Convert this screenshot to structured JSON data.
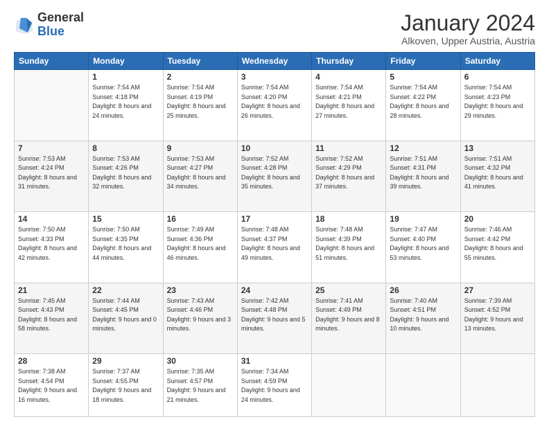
{
  "header": {
    "logo_general": "General",
    "logo_blue": "Blue",
    "title": "January 2024",
    "subtitle": "Alkoven, Upper Austria, Austria"
  },
  "days_of_week": [
    "Sunday",
    "Monday",
    "Tuesday",
    "Wednesday",
    "Thursday",
    "Friday",
    "Saturday"
  ],
  "weeks": [
    [
      {
        "day": "",
        "sunrise": "",
        "sunset": "",
        "daylight": ""
      },
      {
        "day": "1",
        "sunrise": "Sunrise: 7:54 AM",
        "sunset": "Sunset: 4:18 PM",
        "daylight": "Daylight: 8 hours and 24 minutes."
      },
      {
        "day": "2",
        "sunrise": "Sunrise: 7:54 AM",
        "sunset": "Sunset: 4:19 PM",
        "daylight": "Daylight: 8 hours and 25 minutes."
      },
      {
        "day": "3",
        "sunrise": "Sunrise: 7:54 AM",
        "sunset": "Sunset: 4:20 PM",
        "daylight": "Daylight: 8 hours and 26 minutes."
      },
      {
        "day": "4",
        "sunrise": "Sunrise: 7:54 AM",
        "sunset": "Sunset: 4:21 PM",
        "daylight": "Daylight: 8 hours and 27 minutes."
      },
      {
        "day": "5",
        "sunrise": "Sunrise: 7:54 AM",
        "sunset": "Sunset: 4:22 PM",
        "daylight": "Daylight: 8 hours and 28 minutes."
      },
      {
        "day": "6",
        "sunrise": "Sunrise: 7:54 AM",
        "sunset": "Sunset: 4:23 PM",
        "daylight": "Daylight: 8 hours and 29 minutes."
      }
    ],
    [
      {
        "day": "7",
        "sunrise": "Sunrise: 7:53 AM",
        "sunset": "Sunset: 4:24 PM",
        "daylight": "Daylight: 8 hours and 31 minutes."
      },
      {
        "day": "8",
        "sunrise": "Sunrise: 7:53 AM",
        "sunset": "Sunset: 4:26 PM",
        "daylight": "Daylight: 8 hours and 32 minutes."
      },
      {
        "day": "9",
        "sunrise": "Sunrise: 7:53 AM",
        "sunset": "Sunset: 4:27 PM",
        "daylight": "Daylight: 8 hours and 34 minutes."
      },
      {
        "day": "10",
        "sunrise": "Sunrise: 7:52 AM",
        "sunset": "Sunset: 4:28 PM",
        "daylight": "Daylight: 8 hours and 35 minutes."
      },
      {
        "day": "11",
        "sunrise": "Sunrise: 7:52 AM",
        "sunset": "Sunset: 4:29 PM",
        "daylight": "Daylight: 8 hours and 37 minutes."
      },
      {
        "day": "12",
        "sunrise": "Sunrise: 7:51 AM",
        "sunset": "Sunset: 4:31 PM",
        "daylight": "Daylight: 8 hours and 39 minutes."
      },
      {
        "day": "13",
        "sunrise": "Sunrise: 7:51 AM",
        "sunset": "Sunset: 4:32 PM",
        "daylight": "Daylight: 8 hours and 41 minutes."
      }
    ],
    [
      {
        "day": "14",
        "sunrise": "Sunrise: 7:50 AM",
        "sunset": "Sunset: 4:33 PM",
        "daylight": "Daylight: 8 hours and 42 minutes."
      },
      {
        "day": "15",
        "sunrise": "Sunrise: 7:50 AM",
        "sunset": "Sunset: 4:35 PM",
        "daylight": "Daylight: 8 hours and 44 minutes."
      },
      {
        "day": "16",
        "sunrise": "Sunrise: 7:49 AM",
        "sunset": "Sunset: 4:36 PM",
        "daylight": "Daylight: 8 hours and 46 minutes."
      },
      {
        "day": "17",
        "sunrise": "Sunrise: 7:48 AM",
        "sunset": "Sunset: 4:37 PM",
        "daylight": "Daylight: 8 hours and 49 minutes."
      },
      {
        "day": "18",
        "sunrise": "Sunrise: 7:48 AM",
        "sunset": "Sunset: 4:39 PM",
        "daylight": "Daylight: 8 hours and 51 minutes."
      },
      {
        "day": "19",
        "sunrise": "Sunrise: 7:47 AM",
        "sunset": "Sunset: 4:40 PM",
        "daylight": "Daylight: 8 hours and 53 minutes."
      },
      {
        "day": "20",
        "sunrise": "Sunrise: 7:46 AM",
        "sunset": "Sunset: 4:42 PM",
        "daylight": "Daylight: 8 hours and 55 minutes."
      }
    ],
    [
      {
        "day": "21",
        "sunrise": "Sunrise: 7:45 AM",
        "sunset": "Sunset: 4:43 PM",
        "daylight": "Daylight: 8 hours and 58 minutes."
      },
      {
        "day": "22",
        "sunrise": "Sunrise: 7:44 AM",
        "sunset": "Sunset: 4:45 PM",
        "daylight": "Daylight: 9 hours and 0 minutes."
      },
      {
        "day": "23",
        "sunrise": "Sunrise: 7:43 AM",
        "sunset": "Sunset: 4:46 PM",
        "daylight": "Daylight: 9 hours and 3 minutes."
      },
      {
        "day": "24",
        "sunrise": "Sunrise: 7:42 AM",
        "sunset": "Sunset: 4:48 PM",
        "daylight": "Daylight: 9 hours and 5 minutes."
      },
      {
        "day": "25",
        "sunrise": "Sunrise: 7:41 AM",
        "sunset": "Sunset: 4:49 PM",
        "daylight": "Daylight: 9 hours and 8 minutes."
      },
      {
        "day": "26",
        "sunrise": "Sunrise: 7:40 AM",
        "sunset": "Sunset: 4:51 PM",
        "daylight": "Daylight: 9 hours and 10 minutes."
      },
      {
        "day": "27",
        "sunrise": "Sunrise: 7:39 AM",
        "sunset": "Sunset: 4:52 PM",
        "daylight": "Daylight: 9 hours and 13 minutes."
      }
    ],
    [
      {
        "day": "28",
        "sunrise": "Sunrise: 7:38 AM",
        "sunset": "Sunset: 4:54 PM",
        "daylight": "Daylight: 9 hours and 16 minutes."
      },
      {
        "day": "29",
        "sunrise": "Sunrise: 7:37 AM",
        "sunset": "Sunset: 4:55 PM",
        "daylight": "Daylight: 9 hours and 18 minutes."
      },
      {
        "day": "30",
        "sunrise": "Sunrise: 7:35 AM",
        "sunset": "Sunset: 4:57 PM",
        "daylight": "Daylight: 9 hours and 21 minutes."
      },
      {
        "day": "31",
        "sunrise": "Sunrise: 7:34 AM",
        "sunset": "Sunset: 4:59 PM",
        "daylight": "Daylight: 9 hours and 24 minutes."
      },
      {
        "day": "",
        "sunrise": "",
        "sunset": "",
        "daylight": ""
      },
      {
        "day": "",
        "sunrise": "",
        "sunset": "",
        "daylight": ""
      },
      {
        "day": "",
        "sunrise": "",
        "sunset": "",
        "daylight": ""
      }
    ]
  ]
}
